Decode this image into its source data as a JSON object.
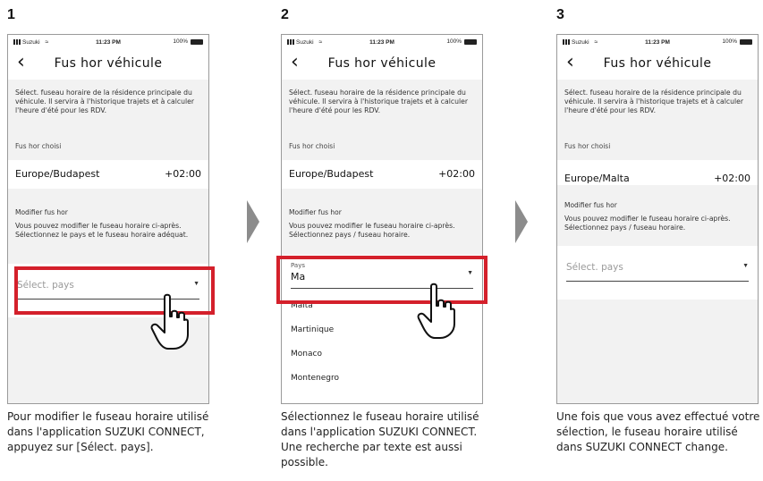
{
  "steps": [
    {
      "number": "1",
      "caption": "Pour modifier le fuseau horaire utilisé dans l'application SUZUKI CONNECT, appuyez sur [Sélect. pays].",
      "status": {
        "carrier": "Suzuki",
        "time": "11:23 PM",
        "battery": "100%"
      },
      "title": "Fus hor véhicule",
      "description": "Sélect. fuseau horaire de la résidence principale du véhicule. Il servira à l'historique trajets et à calculer l'heure d'été pour les RDV.",
      "chosen_label": "Fus hor choisi",
      "timezone": "Europe/Budapest",
      "offset": "+02:00",
      "modify_title": "Modifier fus hor",
      "modify_desc": "Vous pouvez modifier le fuseau horaire ci-après. Sélectionnez le pays et le fuseau horaire adéquat.",
      "select_placeholder": "Sélect. pays"
    },
    {
      "number": "2",
      "caption": "Sélectionnez le fuseau horaire utilisé dans l'application SUZUKI CONNECT. Une recherche par texte est aussi possible.",
      "status": {
        "carrier": "Suzuki",
        "time": "11:23 PM",
        "battery": "100%"
      },
      "title": "Fus hor véhicule",
      "description": "Sélect. fuseau horaire de la résidence principale du véhicule. Il servira à l'historique trajets et à calculer l'heure d'été pour les RDV.",
      "chosen_label": "Fus hor choisi",
      "timezone": "Europe/Budapest",
      "offset": "+02:00",
      "modify_title": "Modifier fus hor",
      "modify_desc": "Vous pouvez modifier le fuseau horaire ci-après. Sélectionnez pays / fuseau horaire.",
      "select_label": "Pays",
      "select_value": "Ma",
      "options": [
        "Malta",
        "Martinique",
        "Monaco",
        "Montenegro"
      ]
    },
    {
      "number": "3",
      "caption": "Une fois que vous avez effectué votre sélection, le fuseau horaire utilisé dans SUZUKI CONNECT change.",
      "status": {
        "carrier": "Suzuki",
        "time": "11:23 PM",
        "battery": "100%"
      },
      "title": "Fus hor véhicule",
      "description": "Sélect. fuseau horaire de la résidence principale du véhicule. Il servira à l'historique trajets et à calculer l'heure d'été pour les RDV.",
      "chosen_label": "Fus hor choisi",
      "timezone": "Europe/Malta",
      "offset": "+02:00",
      "modify_title": "Modifier fus hor",
      "modify_desc": "Vous pouvez modifier le fuseau horaire ci-après. Sélectionnez pays / fuseau horaire.",
      "select_placeholder": "Sélect. pays"
    }
  ],
  "colors": {
    "highlight": "#d4202b",
    "arrow": "#8c8c8c"
  },
  "icons": [
    "back-arrow-icon",
    "dropdown-caret-icon",
    "pointing-hand-icon",
    "next-step-arrow-icon"
  ]
}
